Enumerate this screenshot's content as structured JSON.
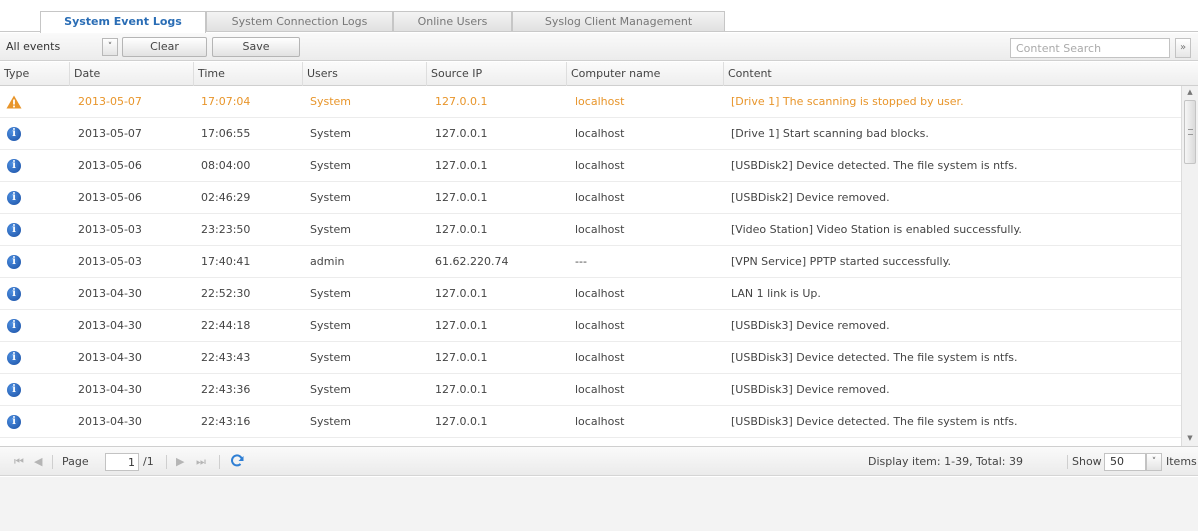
{
  "tabs": [
    {
      "label": "System Event Logs",
      "active": true
    },
    {
      "label": "System Connection Logs",
      "active": false
    },
    {
      "label": "Online Users",
      "active": false
    },
    {
      "label": "Syslog Client Management",
      "active": false
    }
  ],
  "toolbar": {
    "filter_value": "All events",
    "clear_label": "Clear",
    "save_label": "Save",
    "search_placeholder": "Content Search"
  },
  "columns": [
    "Type",
    "Date",
    "Time",
    "Users",
    "Source IP",
    "Computer name",
    "Content"
  ],
  "rows": [
    {
      "type": "warning",
      "date": "2013-05-07",
      "time": "17:07:04",
      "user": "System",
      "ip": "127.0.0.1",
      "computer": "localhost",
      "content": "[Drive 1] The scanning is stopped by user."
    },
    {
      "type": "info",
      "date": "2013-05-07",
      "time": "17:06:55",
      "user": "System",
      "ip": "127.0.0.1",
      "computer": "localhost",
      "content": "[Drive 1] Start scanning bad blocks."
    },
    {
      "type": "info",
      "date": "2013-05-06",
      "time": "08:04:00",
      "user": "System",
      "ip": "127.0.0.1",
      "computer": "localhost",
      "content": "[USBDisk2] Device detected. The file system is ntfs."
    },
    {
      "type": "info",
      "date": "2013-05-06",
      "time": "02:46:29",
      "user": "System",
      "ip": "127.0.0.1",
      "computer": "localhost",
      "content": "[USBDisk2] Device removed."
    },
    {
      "type": "info",
      "date": "2013-05-03",
      "time": "23:23:50",
      "user": "System",
      "ip": "127.0.0.1",
      "computer": "localhost",
      "content": "[Video Station] Video Station is enabled successfully."
    },
    {
      "type": "info",
      "date": "2013-05-03",
      "time": "17:40:41",
      "user": "admin",
      "ip": "61.62.220.74",
      "computer": "---",
      "content": "[VPN Service] PPTP started successfully."
    },
    {
      "type": "info",
      "date": "2013-04-30",
      "time": "22:52:30",
      "user": "System",
      "ip": "127.0.0.1",
      "computer": "localhost",
      "content": "LAN 1 link is Up."
    },
    {
      "type": "info",
      "date": "2013-04-30",
      "time": "22:44:18",
      "user": "System",
      "ip": "127.0.0.1",
      "computer": "localhost",
      "content": "[USBDisk3] Device removed."
    },
    {
      "type": "info",
      "date": "2013-04-30",
      "time": "22:43:43",
      "user": "System",
      "ip": "127.0.0.1",
      "computer": "localhost",
      "content": "[USBDisk3] Device detected. The file system is ntfs."
    },
    {
      "type": "info",
      "date": "2013-04-30",
      "time": "22:43:36",
      "user": "System",
      "ip": "127.0.0.1",
      "computer": "localhost",
      "content": "[USBDisk3] Device removed."
    },
    {
      "type": "info",
      "date": "2013-04-30",
      "time": "22:43:16",
      "user": "System",
      "ip": "127.0.0.1",
      "computer": "localhost",
      "content": "[USBDisk3] Device detected. The file system is ntfs."
    }
  ],
  "pager": {
    "page_label": "Page",
    "current_page": "1",
    "total_pages": "/1",
    "display_text": "Display item: 1-39, Total: 39",
    "show_label": "Show",
    "show_value": "50",
    "items_label": "Items"
  },
  "colors": {
    "accent": "#2a6db5",
    "warning": "#e8952a",
    "info": "#1a4fa3"
  }
}
